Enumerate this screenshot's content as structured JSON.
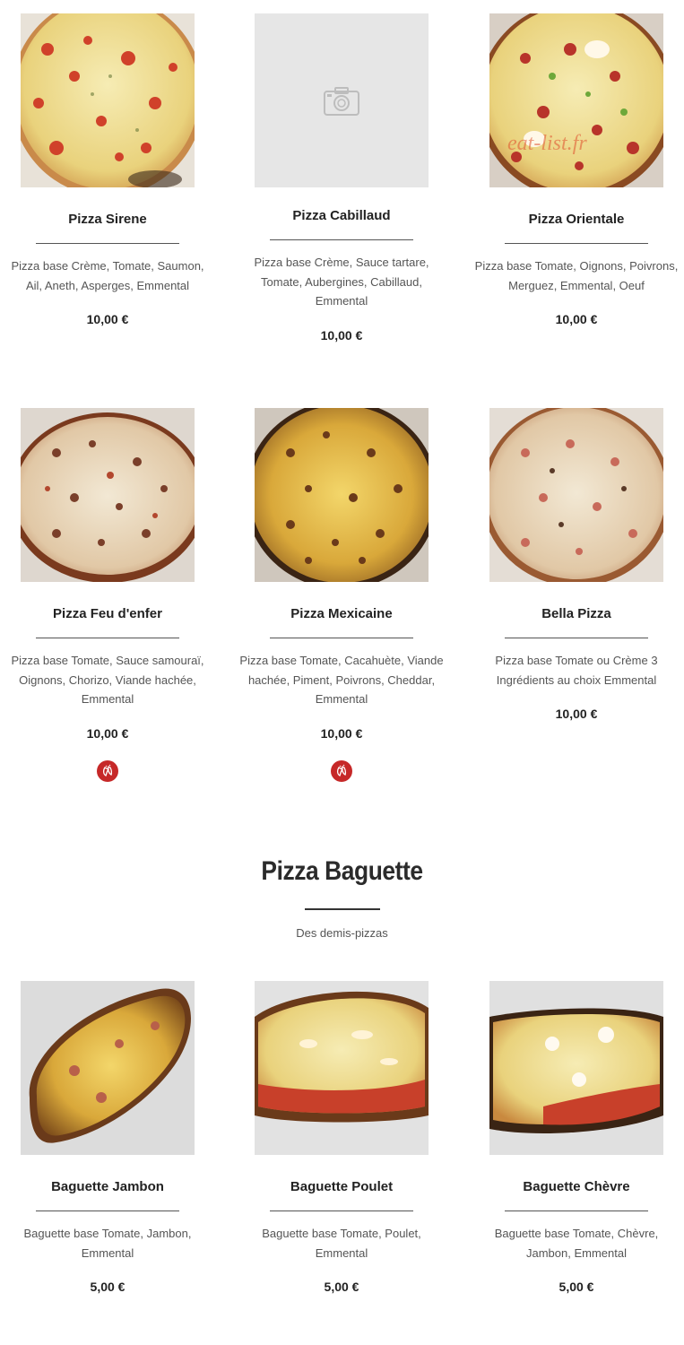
{
  "pizzas": [
    {
      "name": "Pizza Sirene",
      "desc": "Pizza base Crème, Tomate, Saumon, Ail, Aneth, Asperges, Emmental",
      "price": "10,00 €"
    },
    {
      "name": "Pizza Cabillaud",
      "desc": "Pizza base Crème, Sauce tartare, Tomate, Aubergines, Cabillaud, Emmental",
      "price": "10,00 €"
    },
    {
      "name": "Pizza Orientale",
      "desc": "Pizza base Tomate, Oignons, Poivrons, Merguez, Emmental, Oeuf",
      "price": "10,00 €",
      "watermark": "eat-list.fr"
    },
    {
      "name": "Pizza Feu d'enfer",
      "desc": "Pizza base Tomate, Sauce samouraï, Oignons, Chorizo, Viande hachée, Emmental",
      "price": "10,00 €",
      "spicy_icon": "chili-icon"
    },
    {
      "name": "Pizza Mexicaine",
      "desc": "Pizza base Tomate, Cacahuète, Viande hachée, Piment, Poivrons, Cheddar, Emmental",
      "price": "10,00 €",
      "spicy_icon": "chili-icon"
    },
    {
      "name": "Bella Pizza",
      "desc": "Pizza base Tomate ou Crème 3 Ingrédients au choix Emmental",
      "price": "10,00 €"
    }
  ],
  "baguette_section": {
    "title": "Pizza Baguette",
    "subtitle": "Des demis-pizzas"
  },
  "baguettes": [
    {
      "name": "Baguette Jambon",
      "desc": "Baguette base Tomate, Jambon, Emmental",
      "price": "5,00 €"
    },
    {
      "name": "Baguette Poulet",
      "desc": "Baguette base Tomate, Poulet, Emmental",
      "price": "5,00 €"
    },
    {
      "name": "Baguette Chèvre",
      "desc": "Baguette base Tomate, Chèvre, Jambon, Emmental",
      "price": "5,00 €"
    }
  ],
  "colors": {
    "spicy_badge": "#c62828",
    "placeholder_bg": "#e6e6e6"
  }
}
